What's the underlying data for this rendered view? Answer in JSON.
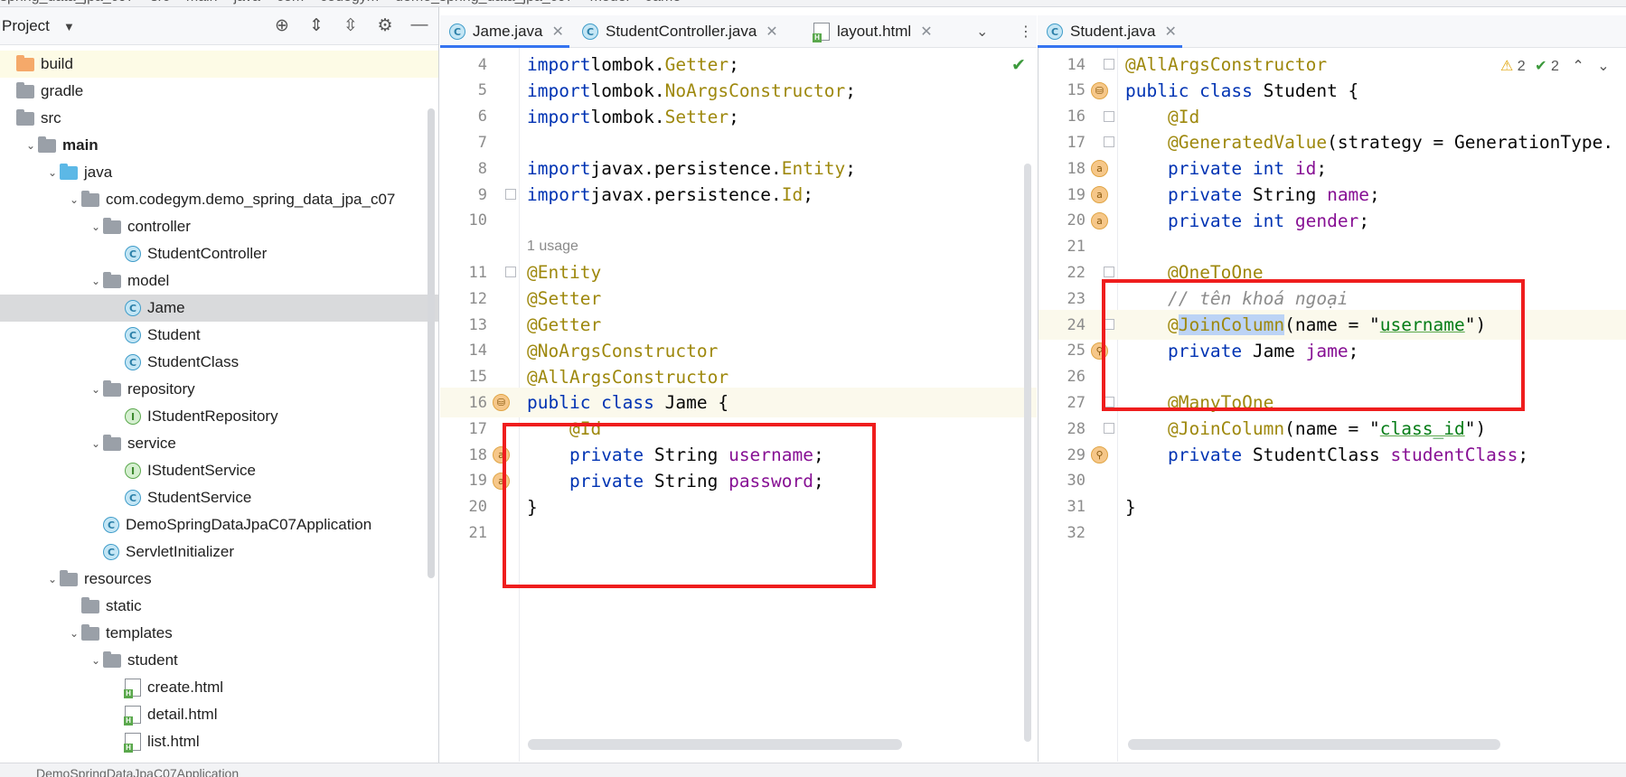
{
  "breadcrumb": [
    "spring_data_jpa_c07",
    "src",
    "main",
    "java",
    "com",
    "codegym",
    "demo_spring_data_jpa_c07",
    "model",
    "Jame"
  ],
  "run_config": "DemoSpringDataJpaC07Application",
  "project_panel": {
    "title": "Project",
    "tree": [
      {
        "label": "build",
        "indent": 0,
        "icon": "folder-orange",
        "arrow": "",
        "state": "highlight"
      },
      {
        "label": "gradle",
        "indent": 0,
        "icon": "folder",
        "arrow": ""
      },
      {
        "label": "src",
        "indent": 0,
        "icon": "folder",
        "arrow": ""
      },
      {
        "label": "main",
        "indent": 1,
        "icon": "folder",
        "arrow": "expanded",
        "bold": true
      },
      {
        "label": "java",
        "indent": 2,
        "icon": "folder-blue",
        "arrow": "expanded"
      },
      {
        "label": "com.codegym.demo_spring_data_jpa_c07",
        "indent": 3,
        "icon": "package",
        "arrow": "expanded"
      },
      {
        "label": "controller",
        "indent": 4,
        "icon": "package",
        "arrow": "expanded"
      },
      {
        "label": "StudentController",
        "indent": 5,
        "icon": "class",
        "arrow": ""
      },
      {
        "label": "model",
        "indent": 4,
        "icon": "package",
        "arrow": "expanded"
      },
      {
        "label": "Jame",
        "indent": 5,
        "icon": "class",
        "arrow": "",
        "state": "selected"
      },
      {
        "label": "Student",
        "indent": 5,
        "icon": "class",
        "arrow": ""
      },
      {
        "label": "StudentClass",
        "indent": 5,
        "icon": "class",
        "arrow": ""
      },
      {
        "label": "repository",
        "indent": 4,
        "icon": "package",
        "arrow": "expanded"
      },
      {
        "label": "IStudentRepository",
        "indent": 5,
        "icon": "interface",
        "arrow": ""
      },
      {
        "label": "service",
        "indent": 4,
        "icon": "package",
        "arrow": "expanded"
      },
      {
        "label": "IStudentService",
        "indent": 5,
        "icon": "interface",
        "arrow": ""
      },
      {
        "label": "StudentService",
        "indent": 5,
        "icon": "class",
        "arrow": ""
      },
      {
        "label": "DemoSpringDataJpaC07Application",
        "indent": 4,
        "icon": "class",
        "arrow": ""
      },
      {
        "label": "ServletInitializer",
        "indent": 4,
        "icon": "class",
        "arrow": ""
      },
      {
        "label": "resources",
        "indent": 2,
        "icon": "folder",
        "arrow": "expanded"
      },
      {
        "label": "static",
        "indent": 3,
        "icon": "folder",
        "arrow": ""
      },
      {
        "label": "templates",
        "indent": 3,
        "icon": "folder",
        "arrow": "expanded"
      },
      {
        "label": "student",
        "indent": 4,
        "icon": "folder",
        "arrow": "expanded"
      },
      {
        "label": "create.html",
        "indent": 5,
        "icon": "html",
        "arrow": ""
      },
      {
        "label": "detail.html",
        "indent": 5,
        "icon": "html",
        "arrow": ""
      },
      {
        "label": "list.html",
        "indent": 5,
        "icon": "html",
        "arrow": ""
      }
    ]
  },
  "left_tabs": [
    {
      "label": "Jame.java",
      "icon": "class",
      "active": true
    },
    {
      "label": "StudentController.java",
      "icon": "class",
      "active": false
    },
    {
      "label": "layout.html",
      "icon": "html",
      "active": false
    }
  ],
  "right_tabs": [
    {
      "label": "Student.java",
      "icon": "class",
      "active": true
    }
  ],
  "right_inspection": {
    "warnings": "2",
    "typos": "2"
  },
  "jame_java": {
    "lines": [
      {
        "num": "4",
        "tokens": [
          [
            "kw",
            "import"
          ],
          [
            "",
            "lombok."
          ],
          [
            "ann",
            "Getter"
          ],
          [
            "",
            ";"
          ]
        ]
      },
      {
        "num": "5",
        "tokens": [
          [
            "kw",
            "import"
          ],
          [
            "",
            "lombok."
          ],
          [
            "ann",
            "NoArgsConstructor"
          ],
          [
            "",
            ";"
          ]
        ]
      },
      {
        "num": "6",
        "tokens": [
          [
            "kw",
            "import"
          ],
          [
            "",
            "lombok."
          ],
          [
            "ann",
            "Setter"
          ],
          [
            "",
            ";"
          ]
        ]
      },
      {
        "num": "7",
        "tokens": []
      },
      {
        "num": "8",
        "tokens": [
          [
            "kw",
            "import"
          ],
          [
            "",
            "javax.persistence."
          ],
          [
            "ann",
            "Entity"
          ],
          [
            "",
            ";"
          ]
        ]
      },
      {
        "num": "9",
        "tokens": [
          [
            "kw",
            "import"
          ],
          [
            "",
            "javax.persistence."
          ],
          [
            "ann",
            "Id"
          ],
          [
            "",
            ";"
          ]
        ]
      },
      {
        "num": "10",
        "tokens": []
      },
      {
        "num": "",
        "usage": "1 usage"
      },
      {
        "num": "11",
        "tokens": [
          [
            "ann",
            "@Entity"
          ]
        ]
      },
      {
        "num": "12",
        "tokens": [
          [
            "ann",
            "@Setter"
          ]
        ]
      },
      {
        "num": "13",
        "tokens": [
          [
            "ann",
            "@Getter"
          ]
        ]
      },
      {
        "num": "14",
        "tokens": [
          [
            "ann",
            "@NoArgsConstructor"
          ]
        ]
      },
      {
        "num": "15",
        "tokens": [
          [
            "ann",
            "@AllArgsConstructor"
          ]
        ]
      },
      {
        "num": "16",
        "tokens": [
          [
            "kw",
            "public class "
          ],
          [
            "",
            "Jame {"
          ]
        ],
        "hl": true
      },
      {
        "num": "17",
        "tokens": [
          [
            "",
            "    "
          ],
          [
            "ann",
            "@Id"
          ]
        ]
      },
      {
        "num": "18",
        "tokens": [
          [
            "",
            "    "
          ],
          [
            "kw",
            "private "
          ],
          [
            "",
            "String "
          ],
          [
            "fld",
            "username"
          ],
          [
            "",
            ";"
          ]
        ]
      },
      {
        "num": "19",
        "tokens": [
          [
            "",
            "    "
          ],
          [
            "kw",
            "private "
          ],
          [
            "",
            "String "
          ],
          [
            "fld",
            "password"
          ],
          [
            "",
            ";"
          ]
        ]
      },
      {
        "num": "20",
        "tokens": [
          [
            "",
            "}"
          ]
        ]
      },
      {
        "num": "21",
        "tokens": []
      }
    ]
  },
  "student_java": {
    "lines": [
      {
        "num": "14",
        "tokens": [
          [
            "ann",
            "@AllArgsConstructor"
          ]
        ]
      },
      {
        "num": "15",
        "tokens": [
          [
            "kw",
            "public class "
          ],
          [
            "",
            "Student {"
          ]
        ]
      },
      {
        "num": "16",
        "tokens": [
          [
            "",
            "    "
          ],
          [
            "ann",
            "@Id"
          ]
        ]
      },
      {
        "num": "17",
        "tokens": [
          [
            "",
            "    "
          ],
          [
            "ann",
            "@GeneratedValue"
          ],
          [
            "",
            "(strategy = GenerationType."
          ]
        ]
      },
      {
        "num": "18",
        "tokens": [
          [
            "",
            "    "
          ],
          [
            "kw",
            "private int "
          ],
          [
            "fld",
            "id"
          ],
          [
            "",
            ";"
          ]
        ]
      },
      {
        "num": "19",
        "tokens": [
          [
            "",
            "    "
          ],
          [
            "kw",
            "private "
          ],
          [
            "",
            "String "
          ],
          [
            "fld",
            "name"
          ],
          [
            "",
            ";"
          ]
        ]
      },
      {
        "num": "20",
        "tokens": [
          [
            "",
            "    "
          ],
          [
            "kw",
            "private int "
          ],
          [
            "fld",
            "gender"
          ],
          [
            "",
            ";"
          ]
        ]
      },
      {
        "num": "21",
        "tokens": []
      },
      {
        "num": "22",
        "tokens": [
          [
            "",
            "    "
          ],
          [
            "ann",
            "@OneToOne"
          ]
        ]
      },
      {
        "num": "23",
        "tokens": [
          [
            "",
            "    "
          ],
          [
            "cmt",
            "// tên khoá ngoại"
          ]
        ]
      },
      {
        "num": "24",
        "tokens": [
          [
            "",
            "    "
          ],
          [
            "ann",
            "@"
          ],
          [
            "annsel",
            "JoinColumn"
          ],
          [
            "",
            "(name = \""
          ],
          [
            "str",
            "username"
          ],
          [
            "",
            "\")"
          ]
        ],
        "hl": true
      },
      {
        "num": "25",
        "tokens": [
          [
            "",
            "    "
          ],
          [
            "kw",
            "private "
          ],
          [
            "",
            "Jame "
          ],
          [
            "fld",
            "jame"
          ],
          [
            "",
            ";"
          ]
        ]
      },
      {
        "num": "26",
        "tokens": []
      },
      {
        "num": "27",
        "tokens": [
          [
            "",
            "    "
          ],
          [
            "ann",
            "@ManyToOne"
          ]
        ]
      },
      {
        "num": "28",
        "tokens": [
          [
            "",
            "    "
          ],
          [
            "ann",
            "@JoinColumn"
          ],
          [
            "",
            "(name = \""
          ],
          [
            "str",
            "class_id"
          ],
          [
            "",
            "\")"
          ]
        ]
      },
      {
        "num": "29",
        "tokens": [
          [
            "",
            "    "
          ],
          [
            "kw",
            "private "
          ],
          [
            "",
            "StudentClass "
          ],
          [
            "fld",
            "studentClass"
          ],
          [
            "",
            ";"
          ]
        ]
      },
      {
        "num": "30",
        "tokens": []
      },
      {
        "num": "31",
        "tokens": [
          [
            "",
            "}"
          ]
        ]
      },
      {
        "num": "32",
        "tokens": []
      }
    ]
  }
}
